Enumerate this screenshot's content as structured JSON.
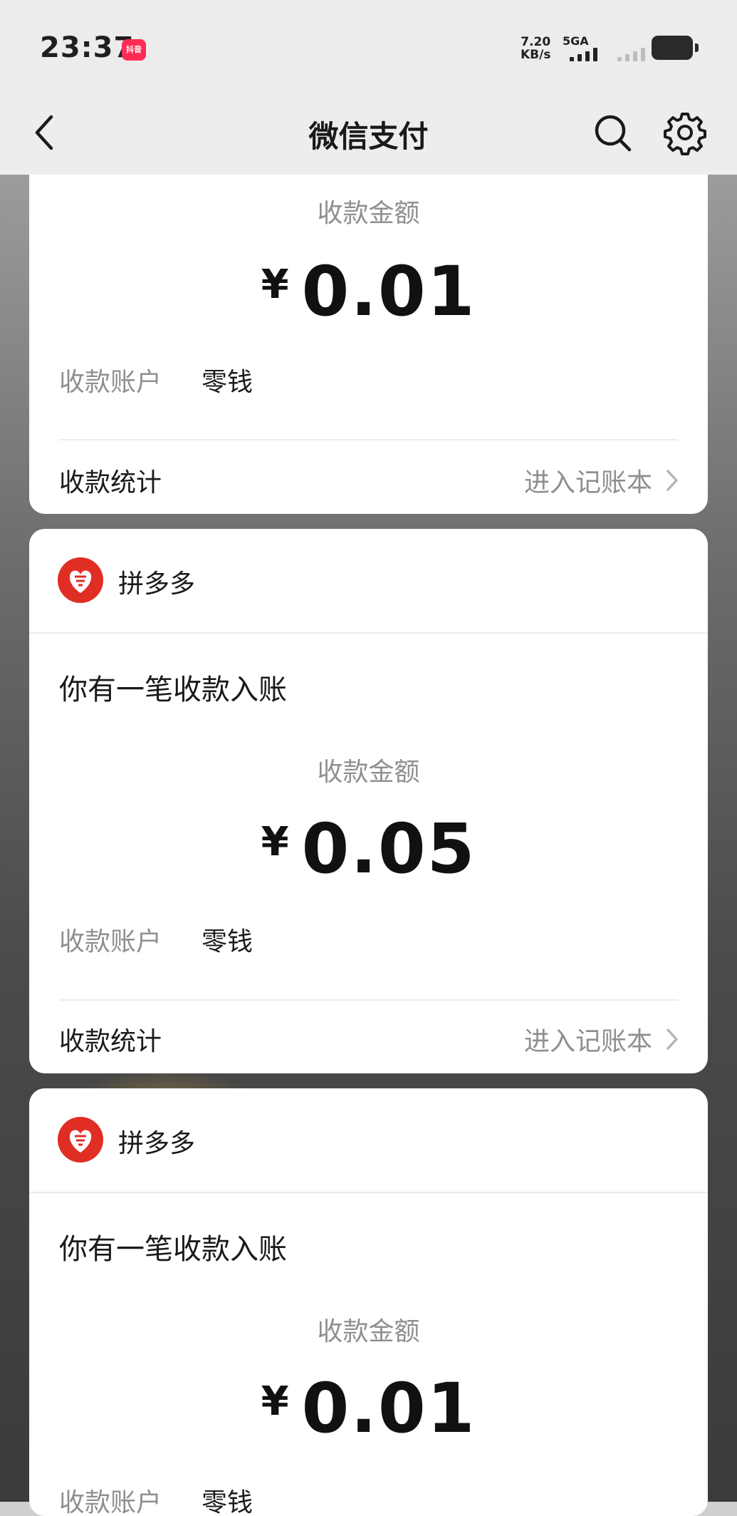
{
  "status_bar": {
    "time": "23:37",
    "app_badge": "抖音",
    "speed_value": "7.20",
    "speed_unit": "KB/s",
    "network": "5GA"
  },
  "nav": {
    "title": "微信支付",
    "back_icon": "chevron-left-icon",
    "search_icon": "search-icon",
    "settings_icon": "gear-icon"
  },
  "cards": [
    {
      "amount_label": "收款金额",
      "currency": "¥",
      "amount": "0.01",
      "account_label": "收款账户",
      "account_value": "零钱",
      "stats_label": "收款统计",
      "ledger_link": "进入记账本"
    },
    {
      "merchant": "拼多多",
      "headline": "你有一笔收款入账",
      "amount_label": "收款金额",
      "currency": "¥",
      "amount": "0.05",
      "account_label": "收款账户",
      "account_value": "零钱",
      "stats_label": "收款统计",
      "ledger_link": "进入记账本"
    },
    {
      "merchant": "拼多多",
      "headline": "你有一笔收款入账",
      "amount_label": "收款金额",
      "currency": "¥",
      "amount": "0.01",
      "account_label": "收款账户",
      "account_value": "零钱"
    }
  ],
  "colors": {
    "brand_red": "#e02e24",
    "text_primary": "#1a1a1a",
    "text_secondary": "#8f8f8f"
  }
}
